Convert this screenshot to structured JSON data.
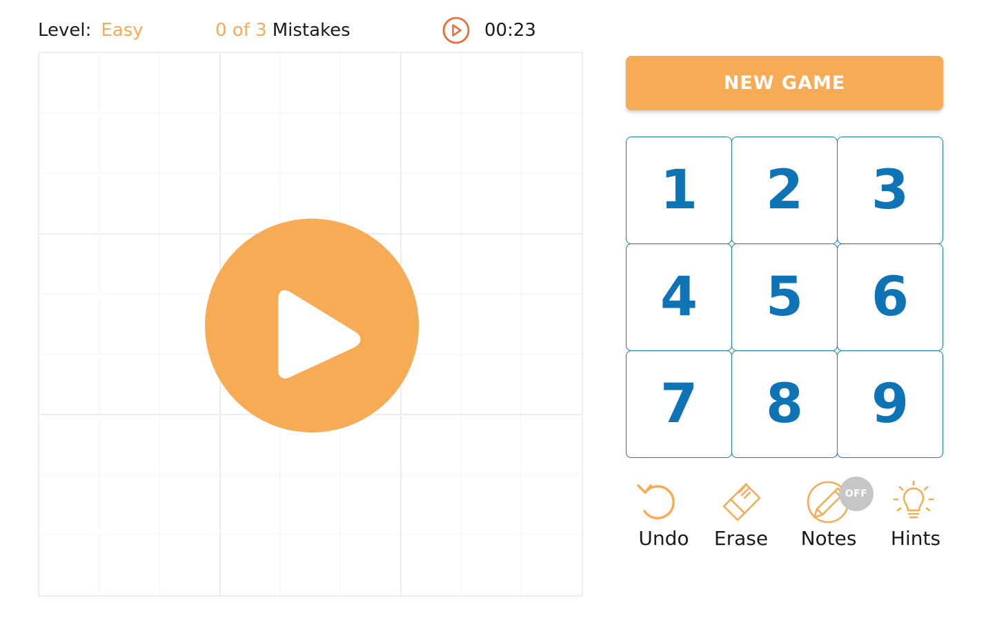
{
  "colors": {
    "accent": "#f8ab55",
    "timer_icon": "#ef6b3a",
    "number_blue": "#0f74b6",
    "key_border": "#1679b8",
    "grid_line": "#eeeeee",
    "badge_off": "#c6c6c6"
  },
  "header": {
    "level_label": "Level:",
    "level_value": "Easy",
    "mistakes_count": "0 of 3",
    "mistakes_label": "Mistakes",
    "timer_icon": "play-circle-icon",
    "time": "00:23"
  },
  "board": {
    "state": "paused",
    "overlay_icon": "play-icon"
  },
  "controls": {
    "new_game_label": "NEW GAME",
    "numbers": [
      "1",
      "2",
      "3",
      "4",
      "5",
      "6",
      "7",
      "8",
      "9"
    ],
    "tools": [
      {
        "label": "Undo",
        "icon": "undo-icon"
      },
      {
        "label": "Erase",
        "icon": "eraser-icon"
      },
      {
        "label": "Notes",
        "icon": "pencil-icon",
        "badge": "OFF"
      },
      {
        "label": "Hints",
        "icon": "lightbulb-icon"
      }
    ]
  }
}
